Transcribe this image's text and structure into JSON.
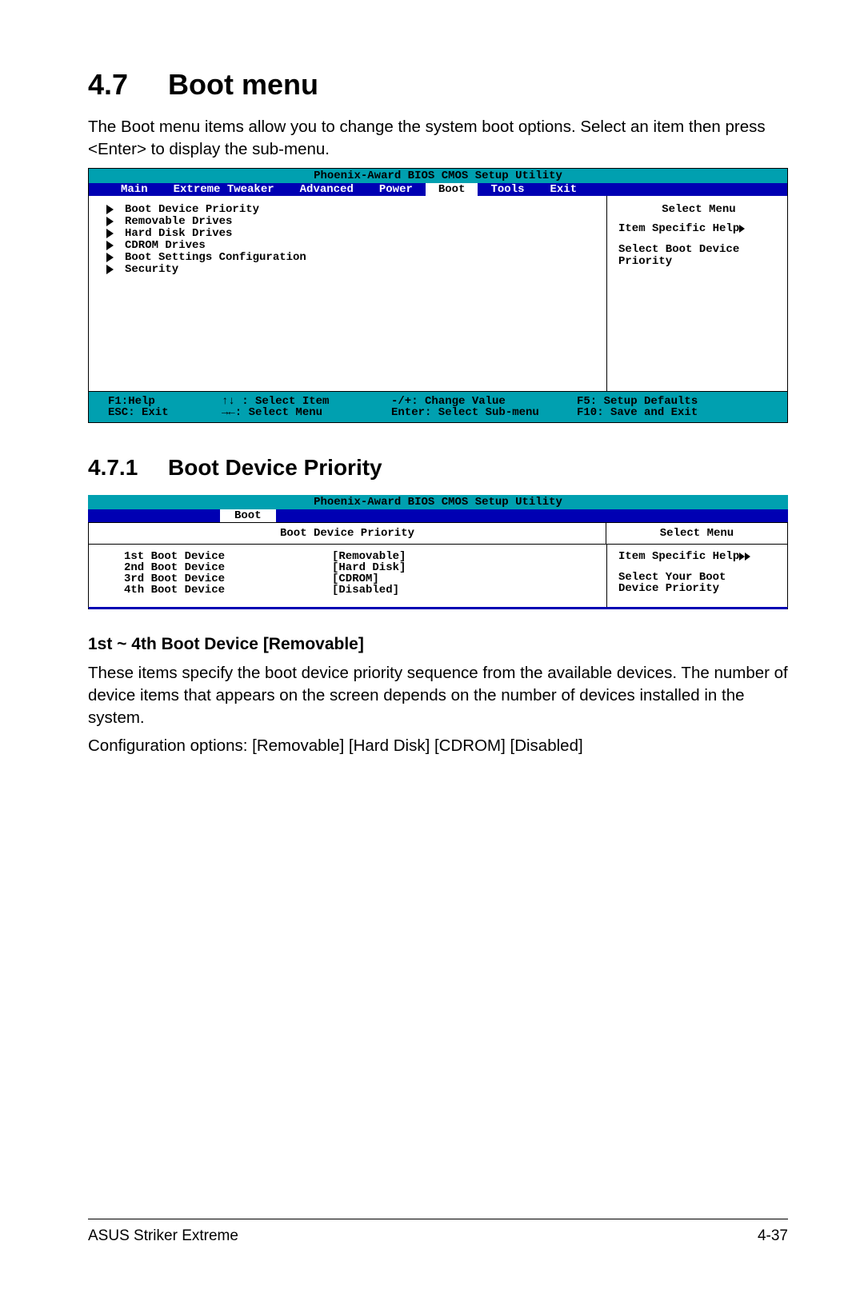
{
  "section": {
    "number": "4.7",
    "title": "Boot menu",
    "intro": "The Boot menu items allow you to change the system boot options. Select an item then press <Enter> to display the sub-menu."
  },
  "bios1": {
    "title": "Phoenix-Award BIOS CMOS Setup Utility",
    "menus": [
      "Main",
      "Extreme Tweaker",
      "Advanced",
      "Power",
      "Boot",
      "Tools",
      "Exit"
    ],
    "active_menu_index": 4,
    "items": [
      "Boot Device Priority",
      "Removable Drives",
      "Hard Disk Drives",
      "CDROM Drives",
      "Boot Settings Configuration",
      "Security"
    ],
    "right": {
      "title": "Select Menu",
      "lines": [
        "Item Specific Help",
        "Select Boot Device",
        "Priority"
      ]
    },
    "footer": {
      "c1a": "F1:Help",
      "c1b": "ESC: Exit",
      "c2a": "↑↓ : Select Item",
      "c2b": "→←: Select Menu",
      "c3a": "-/+: Change Value",
      "c3b": "Enter: Select Sub-menu",
      "c4a": "F5: Setup Defaults",
      "c4b": "F10: Save and Exit"
    }
  },
  "subsection": {
    "number": "4.7.1",
    "title": "Boot Device Priority"
  },
  "bios2": {
    "title": "Phoenix-Award BIOS CMOS Setup Utility",
    "active_tab": "Boot",
    "left_header": "Boot Device Priority",
    "right_header": "Select Menu",
    "rows": [
      {
        "k": "1st Boot Device",
        "v": "[Removable]"
      },
      {
        "k": "2nd Boot Device",
        "v": "[Hard Disk]"
      },
      {
        "k": "3rd Boot Device",
        "v": "[CDROM]"
      },
      {
        "k": "4th Boot Device",
        "v": "[Disabled]"
      }
    ],
    "right": {
      "l1": "Item Specific Help",
      "l2": "Select Your Boot",
      "l3": "Device Priority"
    }
  },
  "option_block": {
    "heading": "1st ~ 4th Boot Device [Removable]",
    "p1": "These items specify the boot device priority sequence from the available devices. The number of device items that appears on the screen depends on the number of devices installed in the system.",
    "p2": "Configuration options: [Removable] [Hard Disk] [CDROM] [Disabled]"
  },
  "footer": {
    "left": "ASUS Striker Extreme",
    "right": "4-37"
  }
}
